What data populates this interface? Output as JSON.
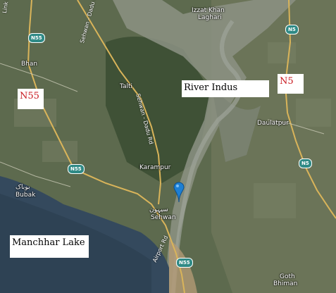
{
  "annotations": {
    "n55": "N55",
    "river_indus": "River Indus",
    "n5": "N5",
    "manchhar_lake": "Manchhar Lake"
  },
  "places": {
    "izzat_khan_line1": "Izzat Khan",
    "izzat_khan_line2": "Laghari",
    "bhan": "Bhan",
    "talti": "Talti",
    "daulatpur": "Daulatpur",
    "karampur": "Karampur",
    "bubak_urdu": "بوباک",
    "bubak": "Bubak",
    "sehwan_urdu": "سیہون",
    "sehwan": "Sehwan",
    "goth_line1": "Goth",
    "goth_line2": "Bhiman"
  },
  "roads": {
    "link_rd": "Link Rd",
    "sehwan_dadu_rd_top": "Sehwan - Dadu Rd",
    "sehwan_dadu_rd_mid": "Sehwan - Dadu Rd",
    "airport_rd": "Airport Rd"
  },
  "shields": {
    "n55_top": "N55",
    "n5_top": "N5",
    "n5_right": "N5",
    "n55_mid": "N55",
    "n55_bottom": "N55"
  },
  "colors": {
    "annotation_red": "#c8161d",
    "lake": "#34495d",
    "river_bed": "#8c9284",
    "vegetation": "#4a5c3d",
    "road": "#d9b45a",
    "pin": "#1d7fd4"
  }
}
